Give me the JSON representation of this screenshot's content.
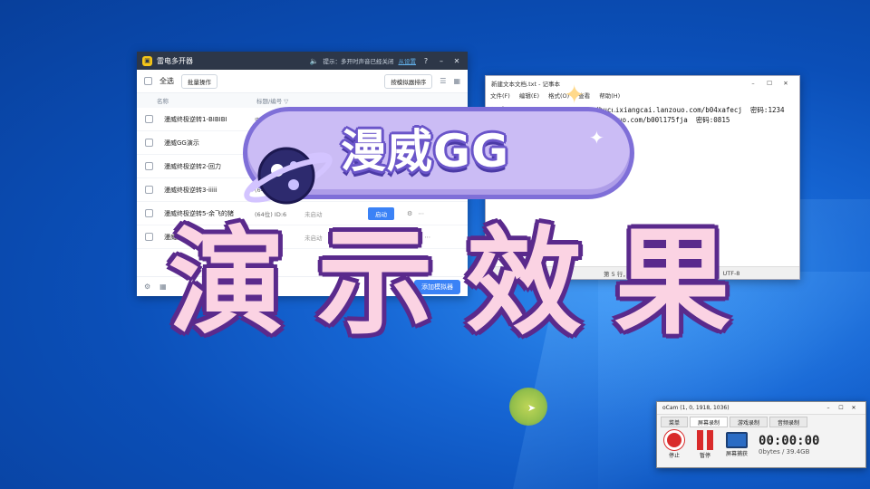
{
  "manager": {
    "title": "雷电多开器",
    "hint": "提示：多开时声音已经关闭",
    "hint_link": "从设置",
    "select_all": "全选",
    "batch": "批量操作",
    "sort": "按模拟器排序",
    "col_name": "名称",
    "col_ver": "标题/编号 ▽",
    "rows": [
      {
        "name": "漫威终极逆转1-BIBIBI",
        "ver": "安卓",
        "status": "",
        "action": ""
      },
      {
        "name": "漫威GG演示",
        "ver": "",
        "status": "",
        "action": ""
      },
      {
        "name": "漫威终极逆转2-回力",
        "ver": "安",
        "status": "",
        "action": ""
      },
      {
        "name": "漫威终极逆转3-iiiii",
        "ver": "(64",
        "status": "",
        "action": ""
      },
      {
        "name": "漫威终极逆转5-余飞的猪",
        "ver": "(64位)  ID:6",
        "status": "未启动",
        "action": "启动"
      },
      {
        "name": "漫威游戏辅助演示",
        "ver": "",
        "status": "未启动",
        "action": ""
      }
    ],
    "add_button": "添加模拟器"
  },
  "notepad": {
    "title": "新建文本文档.txt - 记事本",
    "menu": [
      "文件(F)",
      "编辑(E)",
      "格式(O)",
      "查看",
      "帮助(H)"
    ],
    "lines": [
      "漫威GG                    /buchixiangcai.lanzouo.com/b04xafecj  密码:1234",
      "                          lanzouo.com/b00l175fja  密码:0815"
    ],
    "status_pos": "第 5 行，第 1 列",
    "status_eol": "(LF)",
    "status_enc": "UTF-8"
  },
  "banner": {
    "text": "漫威GG"
  },
  "big_title": [
    "演",
    "示",
    "效",
    "果"
  ],
  "ocam": {
    "title": "oCam (1, 0, 1918, 1036)",
    "tabs": [
      "菜单",
      "屏幕录制",
      "游戏录制",
      "音频录制"
    ],
    "stop": "停止",
    "pause": "暂停",
    "capture": "屏幕捕获",
    "timer": "00:00:00",
    "size": "0bytes / 39.4GB"
  },
  "colors": {
    "desktop": "#0b4fb8",
    "banner_fill": "#cbbcf5",
    "banner_stroke": "#6a55c9",
    "big_title_fill": "#fbd3e3",
    "big_title_stroke": "#5a2a8c",
    "accent_blue": "#3b82f6",
    "record_red": "#d92b2b"
  }
}
